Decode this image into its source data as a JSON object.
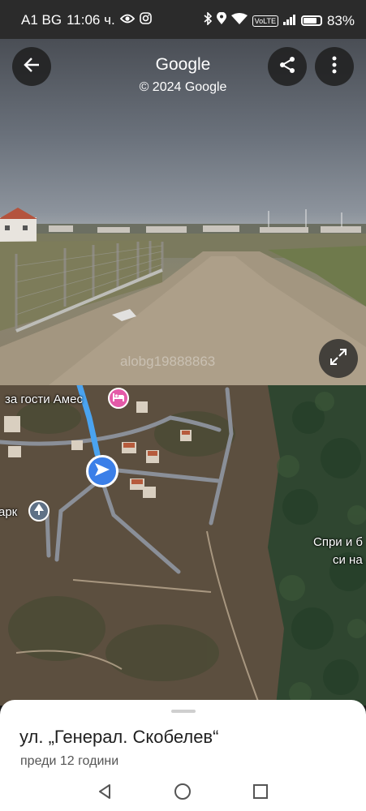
{
  "status_bar": {
    "carrier": "A1 BG",
    "time": "11:06 ч.",
    "battery": "83%",
    "battery_level": 0.83,
    "volte": "VoLTE",
    "icons": [
      "eye-icon",
      "instagram-icon",
      "bluetooth-icon",
      "location-icon",
      "wifi-icon",
      "volte-icon",
      "signal-icon",
      "battery-icon"
    ]
  },
  "street_view": {
    "title": "Google",
    "copyright": "© 2024 Google",
    "watermark": "alobg19888863",
    "icons": [
      "back-arrow-icon",
      "share-icon",
      "more-vertical-icon",
      "expand-icon"
    ]
  },
  "map": {
    "labels": {
      "guesthouse": "за гости Амес",
      "park": "арк",
      "spri": "Спри и б",
      "si": "си на"
    },
    "colors": {
      "road": "#8a8f98",
      "blue_route": "#4aa3f0",
      "marker": "#3b7fe8",
      "hotel_pin": "#e45aa8",
      "park_pin": "#5f7186"
    }
  },
  "bottom_sheet": {
    "title": "ул. „Генерал. Скобелев“",
    "subtitle": "преди 12 години"
  },
  "nav_bar": {
    "icons": [
      "nav-back-icon",
      "nav-home-icon",
      "nav-recent-icon"
    ]
  }
}
